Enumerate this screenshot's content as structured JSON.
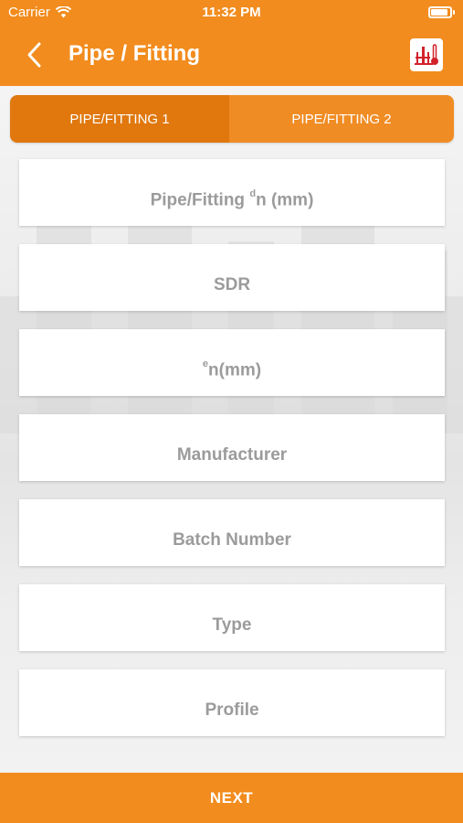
{
  "status_bar": {
    "carrier": "Carrier",
    "time": "11:32 PM"
  },
  "nav": {
    "title": "Pipe / Fitting",
    "back_icon": "chevron-left-icon",
    "app_icon": "welding-app-icon"
  },
  "tabs": [
    {
      "label": "PIPE/FITTING 1",
      "selected": true
    },
    {
      "label": "PIPE/FITTING 2",
      "selected": false
    }
  ],
  "fields": {
    "diameter": {
      "pre": "Pipe/Fitting ",
      "sup": "d",
      "post": "n (mm)"
    },
    "sdr": {
      "label": "SDR"
    },
    "thickness": {
      "sup": "e",
      "post": "n(mm)"
    },
    "manufacturer": {
      "label": "Manufacturer"
    },
    "batch": {
      "label": "Batch Number"
    },
    "type": {
      "label": "Type"
    },
    "profile": {
      "label": "Profile"
    }
  },
  "next_label": "NEXT",
  "colors": {
    "accent": "#f28c1e",
    "tab_selected": "#e0780e",
    "placeholder": "#9b9b9b"
  }
}
